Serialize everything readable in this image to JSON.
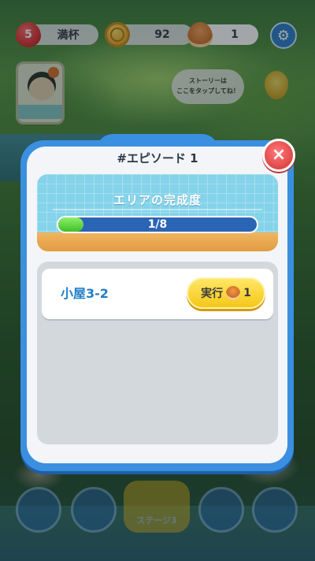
{
  "hud": {
    "lives_count": "5",
    "lives_status": "満杯",
    "coins": "92",
    "dorayaki": "1"
  },
  "background": {
    "story_hint": "ストーリーは\nここをタップしてね！",
    "nav_stage_label": "ステージ3"
  },
  "modal": {
    "title": "#エピソード 1",
    "close_icon": "×",
    "area_label": "エリアの完成度",
    "progress_text": "1/8",
    "progress_value": 0.125,
    "tasks": [
      {
        "name": "小屋3-2",
        "button_label": "実行",
        "cost": "1"
      }
    ]
  },
  "colors": {
    "modal_frame": "#3b8fe0",
    "close_button": "#e04646",
    "task_text": "#1f7fc8",
    "run_button": "#f5c718",
    "progress_fill": "#3fc02a"
  }
}
